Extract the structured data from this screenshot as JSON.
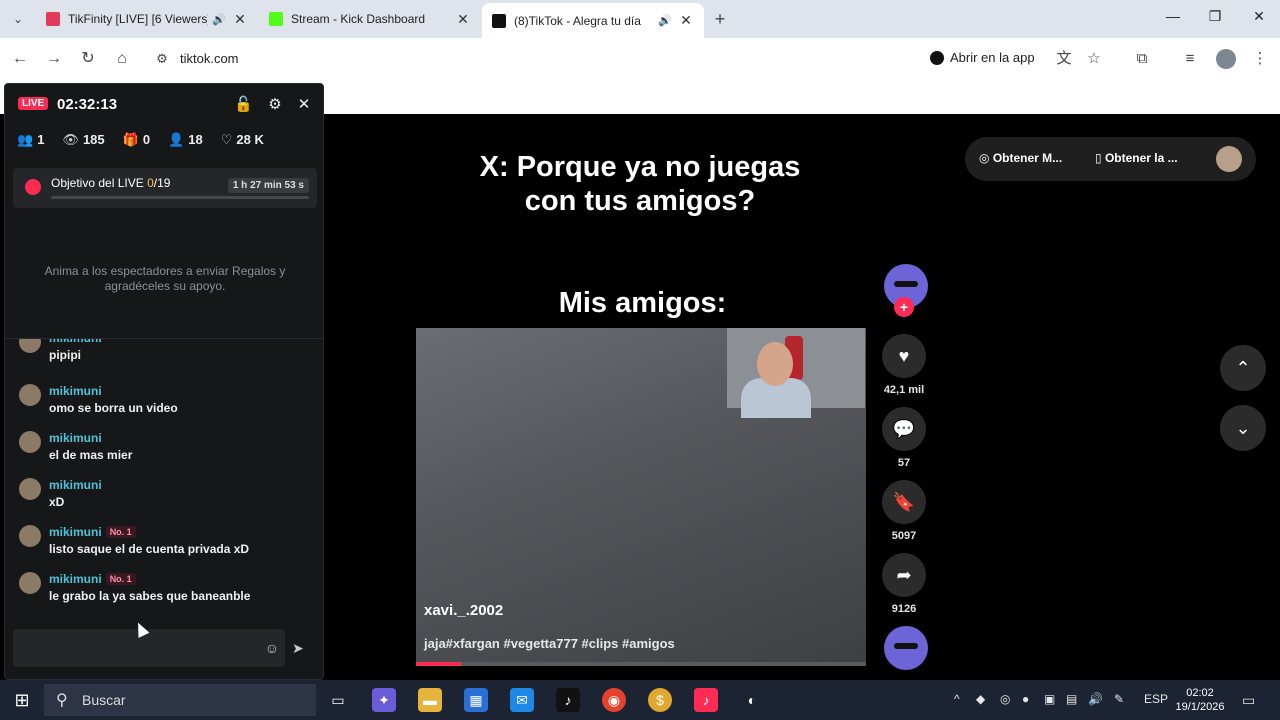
{
  "tabs": [
    {
      "title": "TikFinity [LIVE] [6 Viewers]",
      "icon": "tikfinity-icon",
      "color": "#e23a5a",
      "audio": true
    },
    {
      "title": "Stream - Kick Dashboard",
      "icon": "kick-icon",
      "color": "#53fc18",
      "audio": false
    },
    {
      "title": "(8)TikTok - Alegra tu día",
      "icon": "tiktok-icon",
      "color": "#111111",
      "audio": true
    }
  ],
  "toolbar": {
    "url": "tiktok.com",
    "open_app": "Abrir en la app"
  },
  "panel": {
    "live_label": "LIVE",
    "timer": "02:32:13",
    "stats": {
      "users": "1",
      "views": "185",
      "gifts": "0",
      "followers": "18",
      "likes": "28 K"
    },
    "goal": {
      "label": "Objetivo del LIVE ",
      "progress": "0",
      "total": "/19",
      "time": "1 h 27 min 53 s"
    },
    "hint": "Anima a los espectadores a enviar Regalos y agradéceles su apoyo.",
    "messages": [
      {
        "user": "mikimuni",
        "text": "pipipi",
        "badge": ""
      },
      {
        "user": "mikimuni",
        "text": "omo se borra un video",
        "badge": ""
      },
      {
        "user": "mikimuni",
        "text": "el de mas mier",
        "badge": ""
      },
      {
        "user": "mikimuni",
        "text": "xD",
        "badge": ""
      },
      {
        "user": "mikimuni",
        "text": "listo saque el de cuenta privada xD",
        "badge": "No. 1"
      },
      {
        "user": "mikimuni",
        "text": "le grabo la ya sabes que baneanble",
        "badge": "No. 1"
      }
    ]
  },
  "video": {
    "caption_top": "X: Porque ya no juegas con tus amigos?",
    "caption_bottom": "Mis amigos:",
    "author": "xavi._.2002",
    "tags": "jaja#xfargan #vegetta777 #clips #amigos",
    "progress": 0.1
  },
  "actions": {
    "likes": "42,1 mil",
    "comments": "57",
    "saves": "5097",
    "shares": "9126"
  },
  "topright": {
    "item1": "Obtener M...",
    "item2": "Obtener la ..."
  },
  "taskbar": {
    "search": "Buscar",
    "lang": "ESP",
    "time": "02:02",
    "date": "19/1/2026"
  }
}
